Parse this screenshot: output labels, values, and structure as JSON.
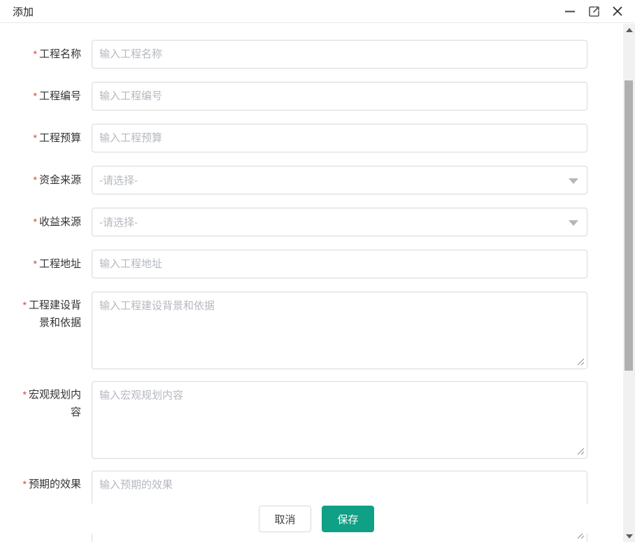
{
  "window": {
    "title": "添加"
  },
  "titlebar": {
    "controls": [
      "minimize-icon",
      "expand-icon",
      "close-icon"
    ]
  },
  "form": {
    "fields": [
      {
        "id": "project-name",
        "label": "工程名称",
        "required": true,
        "type": "input",
        "placeholder": "输入工程名称"
      },
      {
        "id": "project-code",
        "label": "工程编号",
        "required": true,
        "type": "input",
        "placeholder": "输入工程编号"
      },
      {
        "id": "project-budget",
        "label": "工程预算",
        "required": true,
        "type": "input",
        "placeholder": "输入工程预算"
      },
      {
        "id": "funding-source",
        "label": "资金来源",
        "required": true,
        "type": "select",
        "value": "-请选择-"
      },
      {
        "id": "income-source",
        "label": "收益来源",
        "required": true,
        "type": "select",
        "value": "-请选择-"
      },
      {
        "id": "project-address",
        "label": "工程地址",
        "required": true,
        "type": "input",
        "placeholder": "输入工程地址"
      },
      {
        "id": "construction-background",
        "label": "工程建设背景和依据",
        "required": true,
        "type": "textarea",
        "placeholder": "输入工程建设背景和依据"
      },
      {
        "id": "macro-planning",
        "label": "宏观规划内容",
        "required": true,
        "type": "textarea",
        "placeholder": "输入宏观规划内容"
      },
      {
        "id": "expected-effect",
        "label": "预期的效果",
        "required": true,
        "type": "textarea",
        "placeholder": "输入预期的效果"
      }
    ],
    "required_marker": "*"
  },
  "footer": {
    "cancel_label": "取消",
    "save_label": "保存"
  },
  "colors": {
    "accent_teal": "#10a085",
    "required_red": "#e23c39",
    "input_border": "#d9d9d9",
    "placeholder_gray": "#b4b8bf",
    "titlebar_border": "#e9e9e9",
    "scrollbar_track": "#f1f1f1",
    "scrollbar_thumb": "#b0b0b0"
  }
}
